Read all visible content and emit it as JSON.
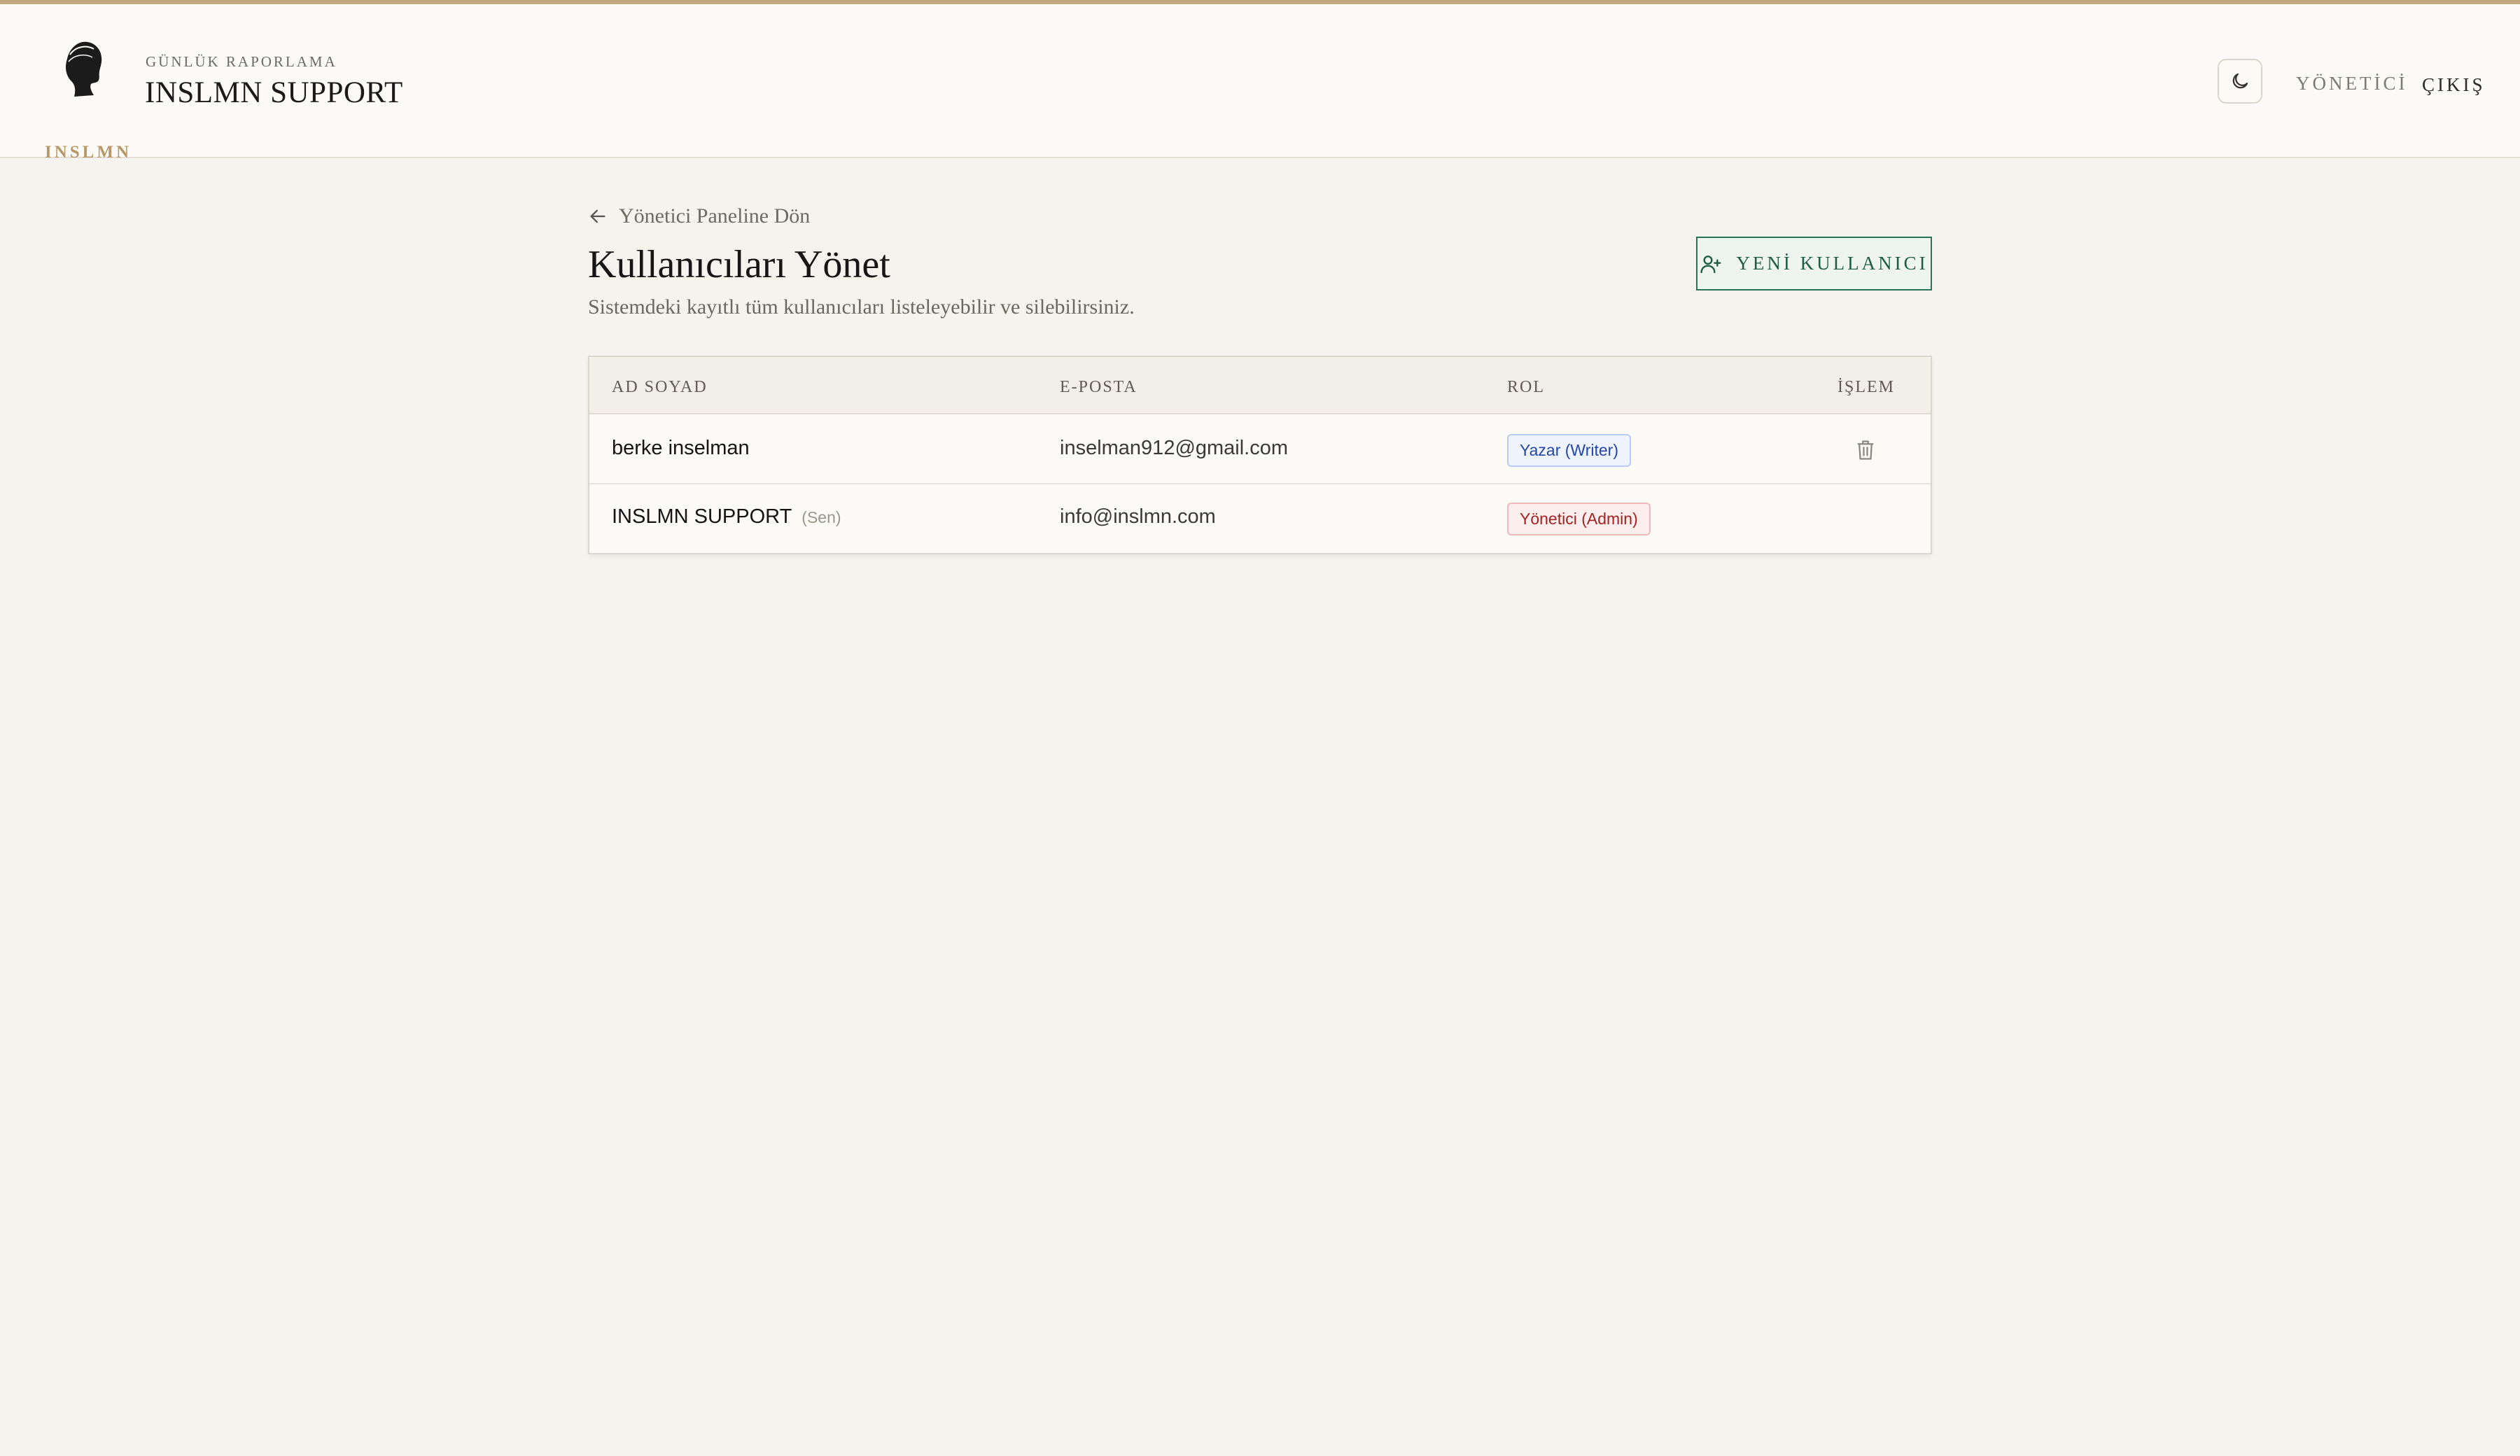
{
  "header": {
    "logo_text": "INSLMN",
    "subtitle": "GÜNLÜK RAPORLAMA",
    "title": "INSLMN SUPPORT",
    "nav": {
      "admin": "YÖNETİCİ",
      "logout": "ÇIKIŞ"
    }
  },
  "page": {
    "back_link": "Yönetici Paneline Dön",
    "title": "Kullanıcıları Yönet",
    "subtitle": "Sistemdeki kayıtlı tüm kullanıcıları listeleyebilir ve silebilirsiniz.",
    "new_user_button": "YENİ KULLANICI"
  },
  "table": {
    "columns": [
      "AD SOYAD",
      "E-POSTA",
      "ROL",
      "İŞLEM"
    ],
    "rows": [
      {
        "name": "berke inselman",
        "you_tag": "",
        "email": "inselman912@gmail.com",
        "role": "Yazar (Writer)"
      },
      {
        "name": "INSLMN SUPPORT",
        "you_tag": "(Sen)",
        "email": "info@inslmn.com",
        "role": "Yönetici (Admin)"
      }
    ]
  },
  "colors": {
    "accent_gold": "#c2a77f",
    "primary_green": "#2e7258",
    "writer_blue": "#2447a6",
    "admin_red": "#a42222"
  }
}
